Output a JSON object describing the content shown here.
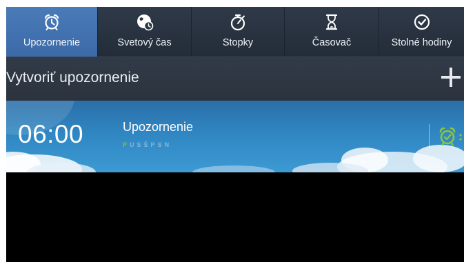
{
  "tabs": [
    {
      "label": "Upozornenie",
      "icon": "alarm-clock-icon",
      "active": true
    },
    {
      "label": "Svetový čas",
      "icon": "world-clock-icon",
      "active": false
    },
    {
      "label": "Stopky",
      "icon": "stopwatch-icon",
      "active": false
    },
    {
      "label": "Časovač",
      "icon": "hourglass-icon",
      "active": false
    },
    {
      "label": "Stolné hodiny",
      "icon": "desk-clock-icon",
      "active": false
    }
  ],
  "create_bar": {
    "title": "Vytvoriť upozornenie",
    "add_icon": "plus-icon"
  },
  "alarm": {
    "time": "06:00",
    "name": "Upozornenie",
    "days": [
      "P",
      "U",
      "S",
      "Š",
      "P",
      "S",
      "N"
    ],
    "active_days": [
      true,
      false,
      false,
      false,
      false,
      false,
      false
    ],
    "enabled": true,
    "toggle_icon": "alarm-clock-icon"
  },
  "colors": {
    "active_tab": "#3c6aa8",
    "alarm_background": "#2f86c2",
    "toggle_on": "#8cc63e"
  }
}
